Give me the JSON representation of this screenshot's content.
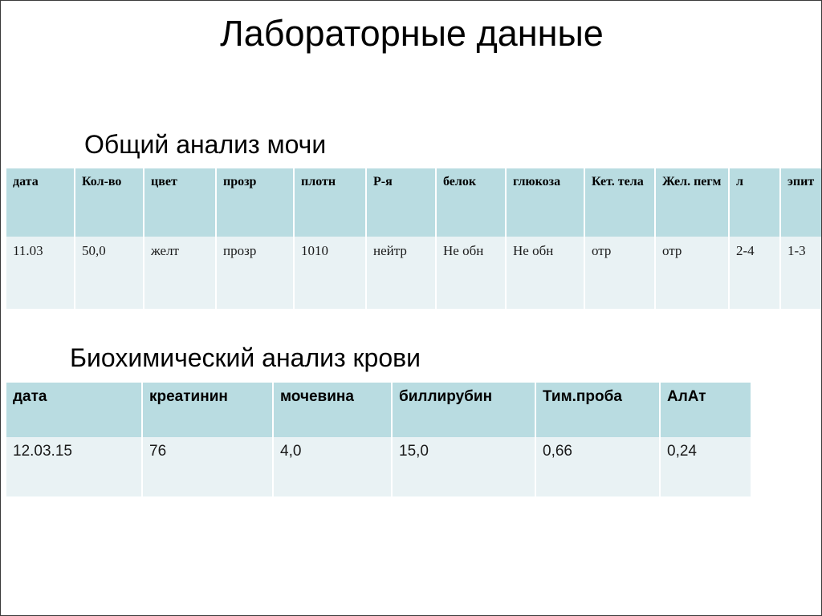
{
  "slide": {
    "title": "Лабораторные данные",
    "background_color": "#ffffff",
    "border_color": "#3a3a3a"
  },
  "palette": {
    "header_fill": "#b9dce1",
    "row_fill": "#e9f2f4",
    "text": "#000000"
  },
  "sections": [
    {
      "heading": "Общий анализ мочи",
      "table": {
        "columns": [
          "дата",
          "Кол-во",
          "цвет",
          "прозр",
          "плотн",
          "Р-я",
          "белок",
          "глюкоза",
          "Кет. тела",
          "Жел. пегм",
          "л",
          "эпит"
        ],
        "rows": [
          [
            "11.03",
            "50,0",
            "желт",
            "прозр",
            "1010",
            "нейтр",
            "Не обн",
            "Не обн",
            "отр",
            "отр",
            "2-4",
            "1-3"
          ]
        ]
      }
    },
    {
      "heading": "Биохимический анализ крови",
      "table": {
        "columns": [
          "дата",
          "креатинин",
          "мочевина",
          "биллирубин",
          "Тим.проба",
          "АлАт"
        ],
        "rows": [
          [
            "12.03.15",
            "76",
            "4,0",
            "15,0",
            "0,66",
            "0,24"
          ]
        ]
      }
    }
  ]
}
